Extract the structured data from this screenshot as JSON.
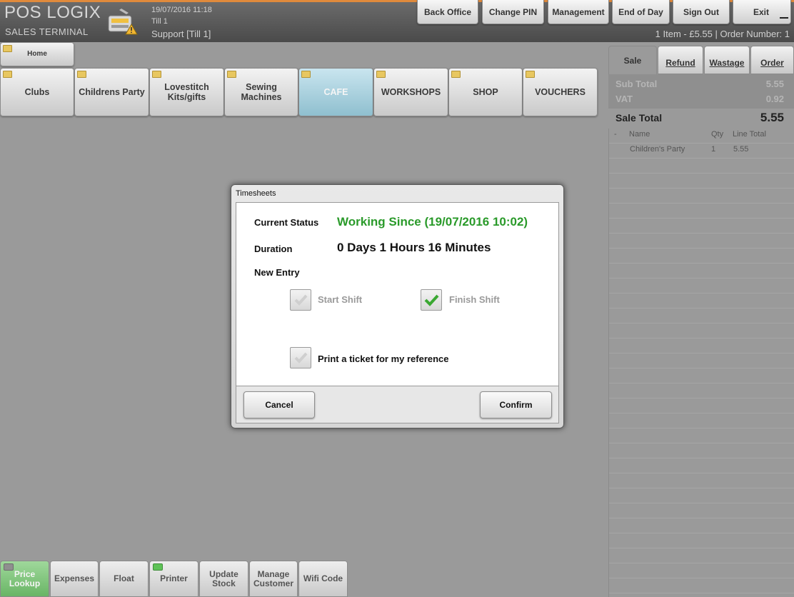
{
  "header": {
    "title": "POS LOGIX",
    "subtitle": "SALES TERMINAL",
    "datetime": "19/07/2016 11:18",
    "till": "Till 1",
    "support": "Support [Till 1]",
    "order_info": "1 Item - £5.55 | Order Number: 1",
    "buttons": [
      "Back Office",
      "Change PIN",
      "Management",
      "End of Day",
      "Sign Out",
      "Exit"
    ]
  },
  "home_label": "Home",
  "categories": [
    "Clubs",
    "Childrens Party",
    "Lovestitch Kits/gifts",
    "Sewing Machines",
    "CAFE",
    "WORKSHOPS",
    "SHOP",
    "VOUCHERS"
  ],
  "active_category": "CAFE",
  "right_panel": {
    "tabs": [
      "Sale",
      "Refund",
      "Wastage",
      "Order"
    ],
    "selected_tab": "Sale",
    "sub_total_label": "Sub Total",
    "sub_total_value": "5.55",
    "vat_label": "VAT",
    "vat_value": "0.92",
    "sale_total_label": "Sale Total",
    "sale_total_value": "5.55",
    "columns": [
      "Name",
      "Qty",
      "Line Total"
    ],
    "rows": [
      {
        "name": "Children's Party",
        "qty": "1",
        "total": "5.55"
      }
    ]
  },
  "bottom_buttons": [
    "Price Lookup",
    "Expenses",
    "Float",
    "Printer",
    "Update Stock",
    "Manage Customer",
    "Wifi Code"
  ],
  "modal": {
    "title": "Timesheets",
    "current_status_label": "Current Status",
    "current_status_value": "Working Since (19/07/2016 10:02)",
    "duration_label": "Duration",
    "duration_value": "0 Days 1 Hours 16 Minutes",
    "new_entry_label": "New Entry",
    "start_shift_label": "Start Shift",
    "finish_shift_label": "Finish Shift",
    "finish_shift_checked": true,
    "print_ticket_label": "Print a ticket for my reference",
    "cancel_label": "Cancel",
    "confirm_label": "Confirm"
  },
  "colors": {
    "accent_orange": "#e08a3c",
    "status_green": "#2a9a2a",
    "cafe_tile": "#a8d3e2"
  }
}
